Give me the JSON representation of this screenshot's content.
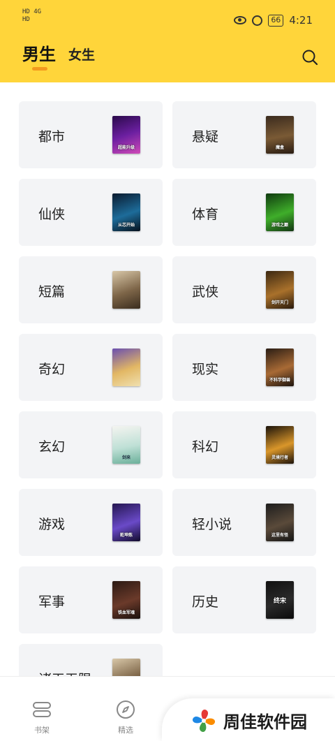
{
  "status_bar": {
    "left_line1": "HD 4G",
    "left_line2": "HD",
    "time": "4:21",
    "battery": "66"
  },
  "tabs": {
    "male": "男生",
    "female": "女生"
  },
  "colors": {
    "header_bg": "#FFD53A",
    "indicator": "#F39A1E",
    "card_bg": "#F3F4F6"
  },
  "categories": [
    {
      "label": "都市",
      "cover_title": "超能升级"
    },
    {
      "label": "悬疑",
      "cover_title": "魔盒"
    },
    {
      "label": "仙侠",
      "cover_title": "从芯开始"
    },
    {
      "label": "体育",
      "cover_title": "游戏之巅"
    },
    {
      "label": "短篇",
      "cover_title": ""
    },
    {
      "label": "武侠",
      "cover_title": "剑开天门"
    },
    {
      "label": "奇幻",
      "cover_title": ""
    },
    {
      "label": "现实",
      "cover_title": "不科学御兽"
    },
    {
      "label": "玄幻",
      "cover_title": "剑来"
    },
    {
      "label": "科幻",
      "cover_title": "灵境行者"
    },
    {
      "label": "游戏",
      "cover_title": "乾坤炼"
    },
    {
      "label": "轻小说",
      "cover_title": "这里有怪"
    },
    {
      "label": "军事",
      "cover_title": "铁血军魂"
    },
    {
      "label": "历史",
      "cover_title": "终宋"
    },
    {
      "label": "诸天无限",
      "cover_title": ""
    }
  ],
  "bottom_nav": [
    {
      "label": "书架",
      "icon": "bookshelf-icon"
    },
    {
      "label": "精选",
      "icon": "compass-icon"
    },
    {
      "label": "",
      "icon": "category-icon"
    },
    {
      "label": "",
      "icon": "profile-icon"
    }
  ],
  "watermark": {
    "text": "周佳软件园"
  }
}
